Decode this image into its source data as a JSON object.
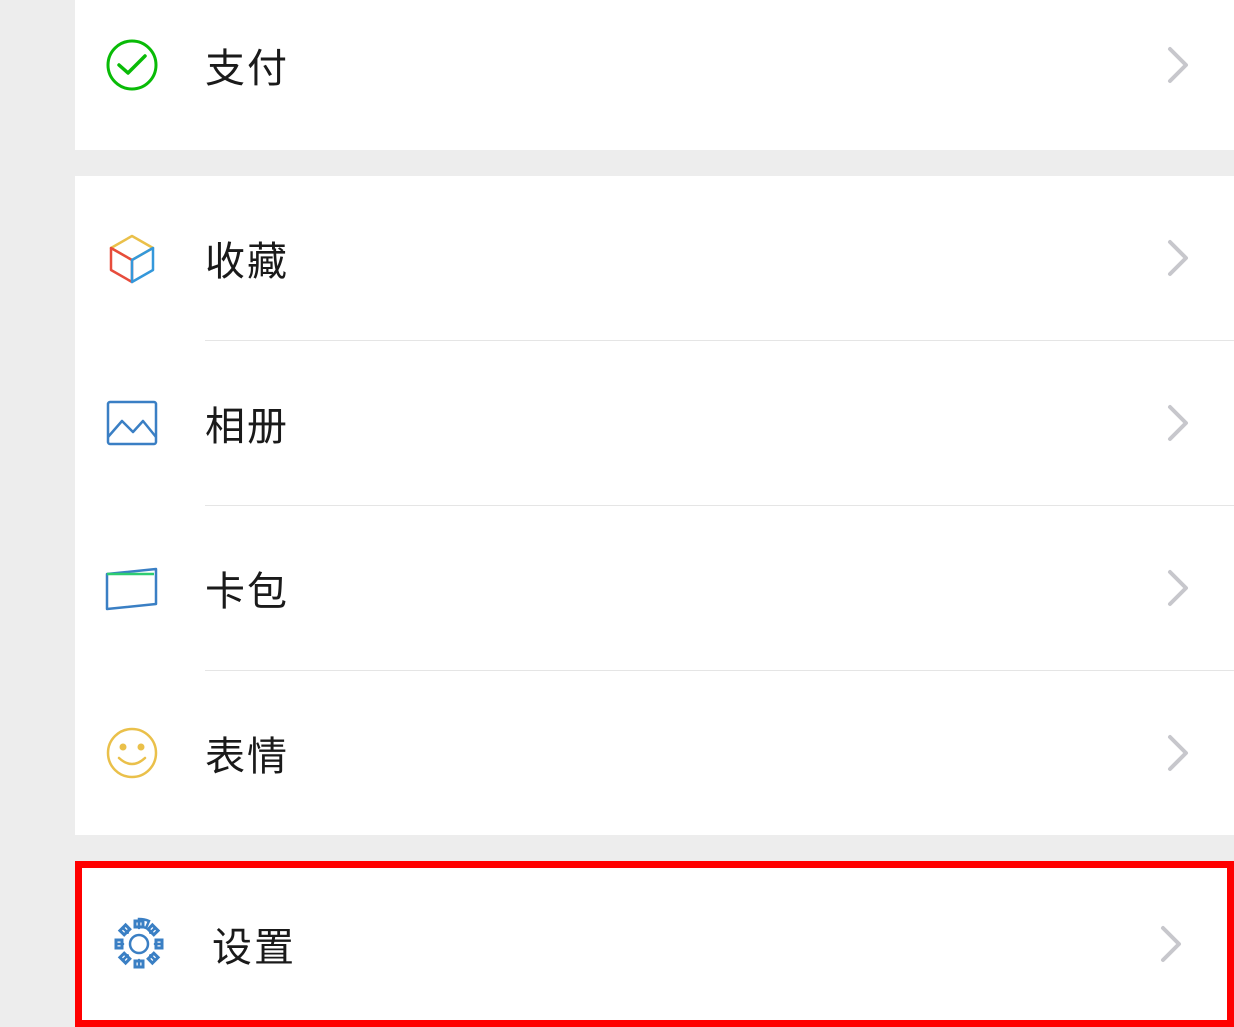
{
  "sections": [
    {
      "items": [
        {
          "id": "pay",
          "label": "支付"
        }
      ]
    },
    {
      "items": [
        {
          "id": "favorites",
          "label": "收藏"
        },
        {
          "id": "album",
          "label": "相册"
        },
        {
          "id": "card-pack",
          "label": "卡包"
        },
        {
          "id": "sticker",
          "label": "表情"
        }
      ]
    },
    {
      "items": [
        {
          "id": "settings",
          "label": "设置"
        }
      ],
      "highlighted": true
    }
  ]
}
